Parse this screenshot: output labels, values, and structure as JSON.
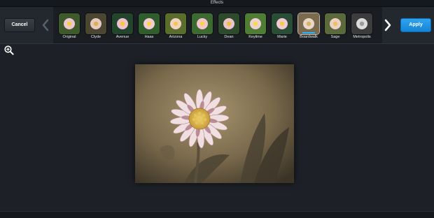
{
  "window": {
    "title": "Effects"
  },
  "toolbar": {
    "cancel_label": "Cancel",
    "apply_label": "Apply",
    "accent_color": "#2ab1ff"
  },
  "effects": [
    {
      "name": "Original",
      "tint": "original"
    },
    {
      "name": "Clyde",
      "tint": "clyde"
    },
    {
      "name": "Avenue",
      "tint": "avenue"
    },
    {
      "name": "Haas",
      "tint": "haas"
    },
    {
      "name": "Arizona",
      "tint": "arizona"
    },
    {
      "name": "Lucky",
      "tint": "lucky"
    },
    {
      "name": "Dean",
      "tint": "dean"
    },
    {
      "name": "Keylime",
      "tint": "keylime"
    },
    {
      "name": "Marie",
      "tint": "marie"
    },
    {
      "name": "Boardwalk",
      "tint": "boardwalk",
      "selected": true
    },
    {
      "name": "Sage",
      "tint": "sage"
    },
    {
      "name": "Metropolis",
      "tint": "metropolis"
    }
  ],
  "icons": {
    "zoom": "zoom-in-icon",
    "prev": "chevron-left-icon",
    "next": "chevron-right-icon"
  }
}
